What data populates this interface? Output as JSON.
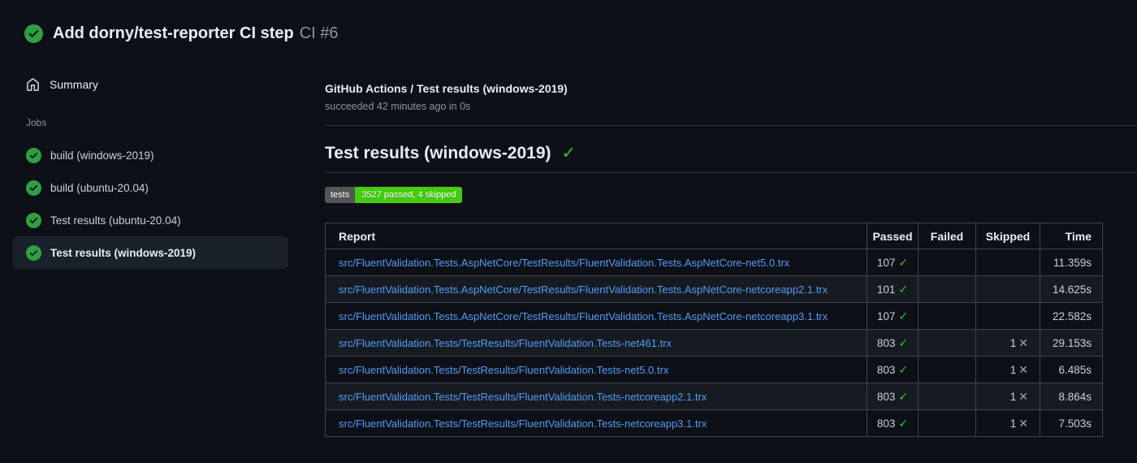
{
  "window": {
    "title": "Add dorny/test-reporter CI step",
    "run_number": "CI #6"
  },
  "sidebar": {
    "summary_label": "Summary",
    "jobs_section_label": "Jobs",
    "jobs": [
      {
        "label": "build (windows-2019)",
        "status": "success",
        "selected": false
      },
      {
        "label": "build (ubuntu-20.04)",
        "status": "success",
        "selected": false
      },
      {
        "label": "Test results (ubuntu-20.04)",
        "status": "success",
        "selected": false
      },
      {
        "label": "Test results (windows-2019)",
        "status": "success",
        "selected": true
      }
    ]
  },
  "main": {
    "check_run_title": "GitHub Actions / Test results (windows-2019)",
    "check_run_status": "succeeded 42 minutes ago in 0s",
    "report_heading": "Test results (windows-2019)",
    "badge": {
      "label": "tests",
      "value": "3527 passed, 4 skipped",
      "label_bg": "#555555",
      "value_bg": "#44cc11"
    },
    "table": {
      "headers": [
        "Report",
        "Passed",
        "Failed",
        "Skipped",
        "Time"
      ],
      "rows": [
        {
          "report": "src/FluentValidation.Tests.AspNetCore/TestResults/FluentValidation.Tests.AspNetCore-net5.0.trx",
          "passed": "107",
          "failed": "",
          "skipped": "",
          "time": "11.359s"
        },
        {
          "report": "src/FluentValidation.Tests.AspNetCore/TestResults/FluentValidation.Tests.AspNetCore-netcoreapp2.1.trx",
          "passed": "101",
          "failed": "",
          "skipped": "",
          "time": "14.625s"
        },
        {
          "report": "src/FluentValidation.Tests.AspNetCore/TestResults/FluentValidation.Tests.AspNetCore-netcoreapp3.1.trx",
          "passed": "107",
          "failed": "",
          "skipped": "",
          "time": "22.582s"
        },
        {
          "report": "src/FluentValidation.Tests/TestResults/FluentValidation.Tests-net461.trx",
          "passed": "803",
          "failed": "",
          "skipped": "1",
          "time": "29.153s"
        },
        {
          "report": "src/FluentValidation.Tests/TestResults/FluentValidation.Tests-net5.0.trx",
          "passed": "803",
          "failed": "",
          "skipped": "1",
          "time": "6.485s"
        },
        {
          "report": "src/FluentValidation.Tests/TestResults/FluentValidation.Tests-netcoreapp2.1.trx",
          "passed": "803",
          "failed": "",
          "skipped": "1",
          "time": "8.864s"
        },
        {
          "report": "src/FluentValidation.Tests/TestResults/FluentValidation.Tests-netcoreapp3.1.trx",
          "passed": "803",
          "failed": "",
          "skipped": "1",
          "time": "7.503s"
        }
      ]
    }
  },
  "icons": {
    "status_success": "check-circle-icon",
    "summary": "home-icon",
    "passed_mark": "✓",
    "skipped_mark": "✕",
    "heading_mark": "✓"
  },
  "colors": {
    "page_bg": "#0d1117",
    "success_circle_green": "#2ea043",
    "check_green": "#2fc32f",
    "x_gray": "#9ea7b1",
    "link_blue": "#539bf5",
    "row_alt_bg": "#161b22",
    "selected_item_bg": "#1b212b",
    "border_gray": "#3d444d"
  }
}
